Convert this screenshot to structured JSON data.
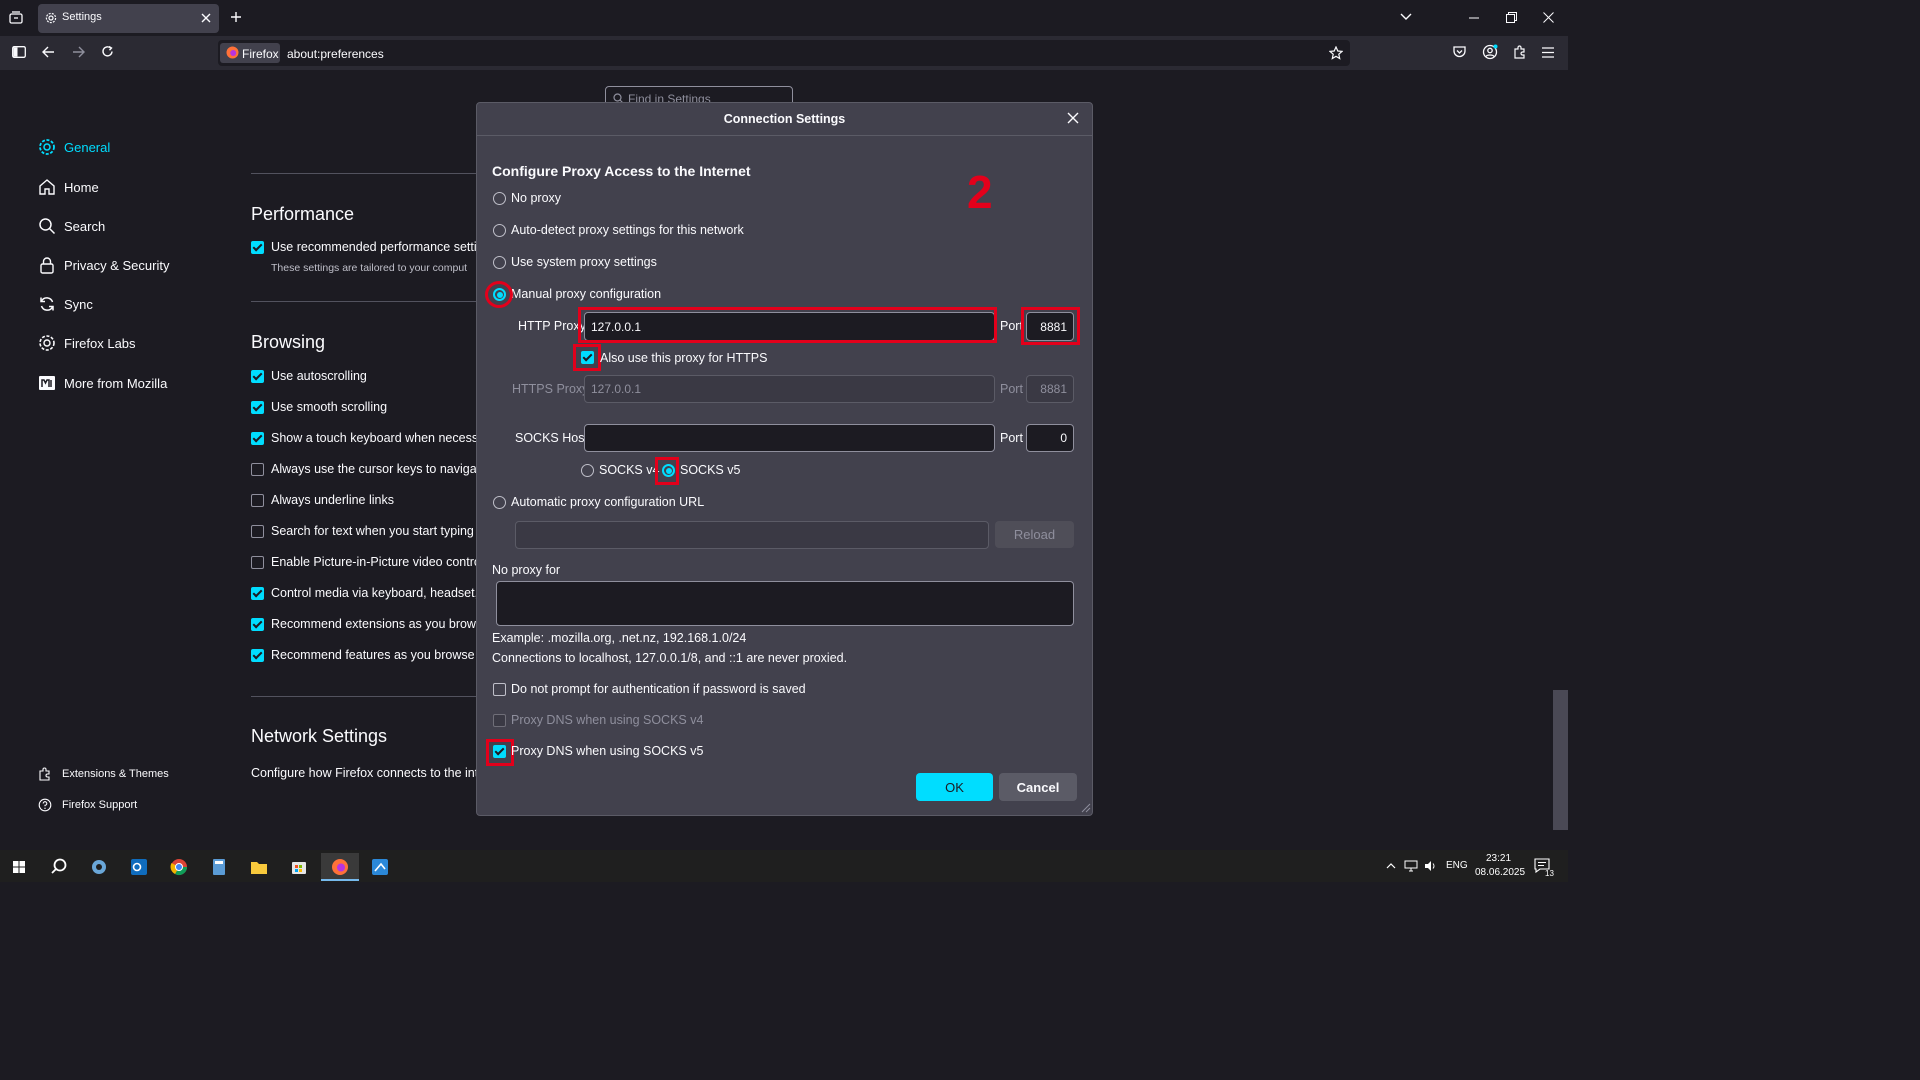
{
  "browser": {
    "tab_title": "Settings",
    "identity_label": "Firefox",
    "url": "about:preferences"
  },
  "find": {
    "placeholder": "Find in Settings"
  },
  "sidebar": {
    "items": [
      {
        "label": "General",
        "icon": "gear-icon"
      },
      {
        "label": "Home",
        "icon": "home-icon"
      },
      {
        "label": "Search",
        "icon": "search-icon"
      },
      {
        "label": "Privacy & Security",
        "icon": "lock-icon"
      },
      {
        "label": "Sync",
        "icon": "sync-icon"
      },
      {
        "label": "Firefox Labs",
        "icon": "labs-icon"
      },
      {
        "label": "More from Mozilla",
        "icon": "mozilla-icon"
      }
    ],
    "footer": [
      {
        "label": "Extensions & Themes",
        "icon": "puzzle-icon"
      },
      {
        "label": "Firefox Support",
        "icon": "help-icon"
      }
    ]
  },
  "main": {
    "performance_title": "Performance",
    "performance_row": "Use recommended performance settin",
    "performance_note": "These settings are tailored to your comput",
    "browsing_title": "Browsing",
    "browsing_rows": [
      {
        "label": "Use autoscrolling",
        "checked": true
      },
      {
        "label": "Use smooth scrolling",
        "checked": true
      },
      {
        "label": "Show a touch keyboard when necessa",
        "checked": true
      },
      {
        "label": "Always use the cursor keys to navigate",
        "checked": false
      },
      {
        "label": "Always underline links",
        "checked": false
      },
      {
        "label": "Search for text when you start typing",
        "checked": false
      },
      {
        "label": "Enable Picture-in-Picture video contro",
        "checked": false
      },
      {
        "label": "Control media via keyboard, headset, c",
        "checked": true
      },
      {
        "label": "Recommend extensions as you browse",
        "checked": true
      },
      {
        "label": "Recommend features as you browse",
        "checked": true
      }
    ],
    "network_title": "Network Settings",
    "network_desc": "Configure how Firefox connects to the int"
  },
  "dialog": {
    "title": "Connection Settings",
    "heading": "Configure Proxy Access to the Internet",
    "annotation": "2",
    "options": {
      "no_proxy": "No proxy",
      "auto_detect": "Auto-detect proxy settings for this network",
      "system": "Use system proxy settings",
      "manual": "Manual proxy configuration",
      "auto_url": "Automatic proxy configuration URL"
    },
    "selected_option": "manual",
    "http_proxy_label": "HTTP Proxy",
    "http_proxy_value": "127.0.0.1",
    "port_label": "Port",
    "http_port": "8881",
    "also_https_label": "Also use this proxy for HTTPS",
    "also_https_checked": true,
    "https_proxy_label": "HTTPS Proxy",
    "https_proxy_value": "127.0.0.1",
    "https_port": "8881",
    "socks_host_label": "SOCKS Host",
    "socks_host_value": "",
    "socks_port": "0",
    "socks_v4_label": "SOCKS v4",
    "socks_v5_label": "SOCKS v5",
    "socks_version": "v5",
    "pac_url_value": "",
    "reload_label": "Reload",
    "no_proxy_for_label": "No proxy for",
    "no_proxy_for_value": "",
    "example_text": "Example: .mozilla.org, .net.nz, 192.168.1.0/24",
    "localhost_note": "Connections to localhost, 127.0.0.1/8, and ::1 are never proxied.",
    "no_prompt_label": "Do not prompt for authentication if password is saved",
    "no_prompt_checked": false,
    "dns_v4_label": "Proxy DNS when using SOCKS v4",
    "dns_v4_checked": false,
    "dns_v5_label": "Proxy DNS when using SOCKS v5",
    "dns_v5_checked": true,
    "ok_label": "OK",
    "cancel_label": "Cancel"
  },
  "taskbar": {
    "language": "ENG",
    "time": "23:21",
    "date": "08.06.2025",
    "notification_count": "13"
  },
  "colors": {
    "accent": "#00ddff",
    "annotation_red": "#e3001b",
    "page_bg": "#1c1b22",
    "dialog_bg": "#42414d"
  }
}
